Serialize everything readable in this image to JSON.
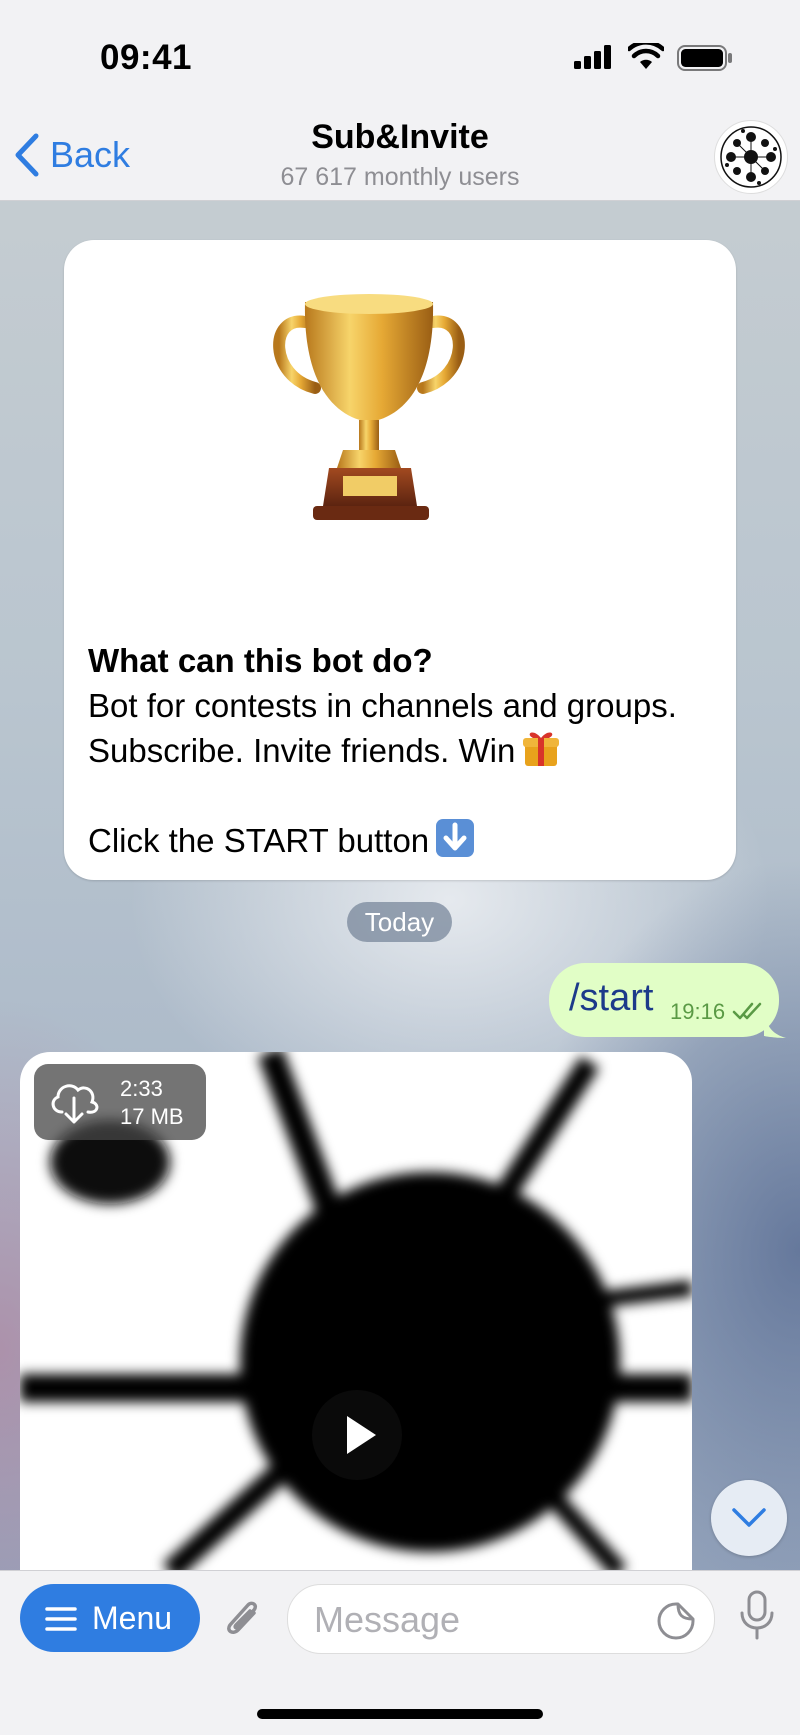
{
  "status_bar": {
    "time": "09:41"
  },
  "nav": {
    "back_label": "Back",
    "title": "Sub&Invite",
    "subtitle": "67 617 monthly users",
    "avatar_icon": "bot-avatar-icon"
  },
  "bot_info": {
    "heading": "What can this bot do?",
    "line1": "Bot for contests in channels and groups.",
    "line2": "Subscribe. Invite friends. Win",
    "line3": "Click the START button",
    "image": "trophy-icon"
  },
  "date_separator": "Today",
  "outgoing_message": {
    "text": "/start",
    "time": "19:16",
    "status": "read"
  },
  "video_message": {
    "duration": "2:33",
    "size": "17 MB"
  },
  "input_bar": {
    "menu_label": "Menu",
    "placeholder": "Message"
  },
  "colors": {
    "accent": "#2f7de1",
    "outgoing_bubble": "#e1fec6"
  }
}
